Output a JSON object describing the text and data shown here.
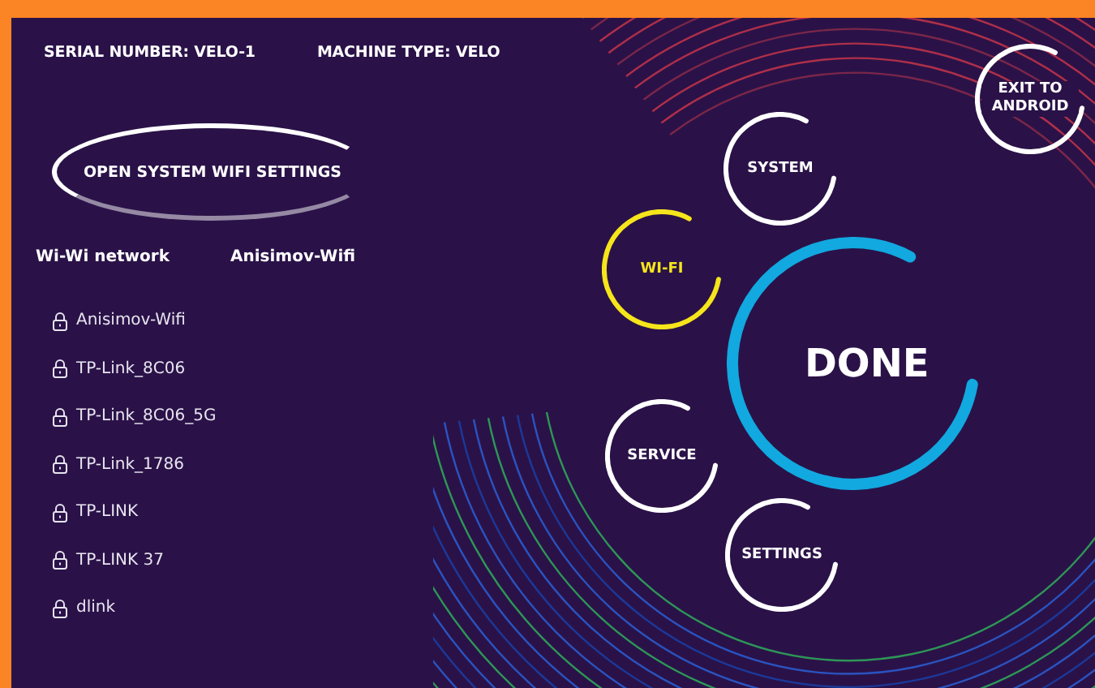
{
  "header": {
    "serial_number": "SERIAL NUMBER: VELO-1",
    "machine_type": "MACHINE TYPE: VELO"
  },
  "wifi_settings_button": "OPEN SYSTEM WIFI SETTINGS",
  "current_network": {
    "label": "Wi-Wi network",
    "value": "Anisimov-Wifi"
  },
  "networks": [
    {
      "name": "Anisimov-Wifi",
      "locked": true
    },
    {
      "name": "TP-Link_8C06",
      "locked": true
    },
    {
      "name": "TP-Link_8C06_5G",
      "locked": true
    },
    {
      "name": "TP-Link_1786",
      "locked": true
    },
    {
      "name": "TP-LINK",
      "locked": true
    },
    {
      "name": "TP-LINK 37",
      "locked": true
    },
    {
      "name": "dlink",
      "locked": true
    }
  ],
  "menu": [
    {
      "label": "EXIT TO ANDROID",
      "kind": "small",
      "selected": false
    },
    {
      "label": "SYSTEM",
      "kind": "small",
      "selected": false
    },
    {
      "label": "WI-FI",
      "kind": "small",
      "selected": true
    },
    {
      "label": "DONE",
      "kind": "main",
      "selected": false
    },
    {
      "label": "SERVICE",
      "kind": "small",
      "selected": false
    },
    {
      "label": "SETTINGS",
      "kind": "small",
      "selected": false
    }
  ]
}
